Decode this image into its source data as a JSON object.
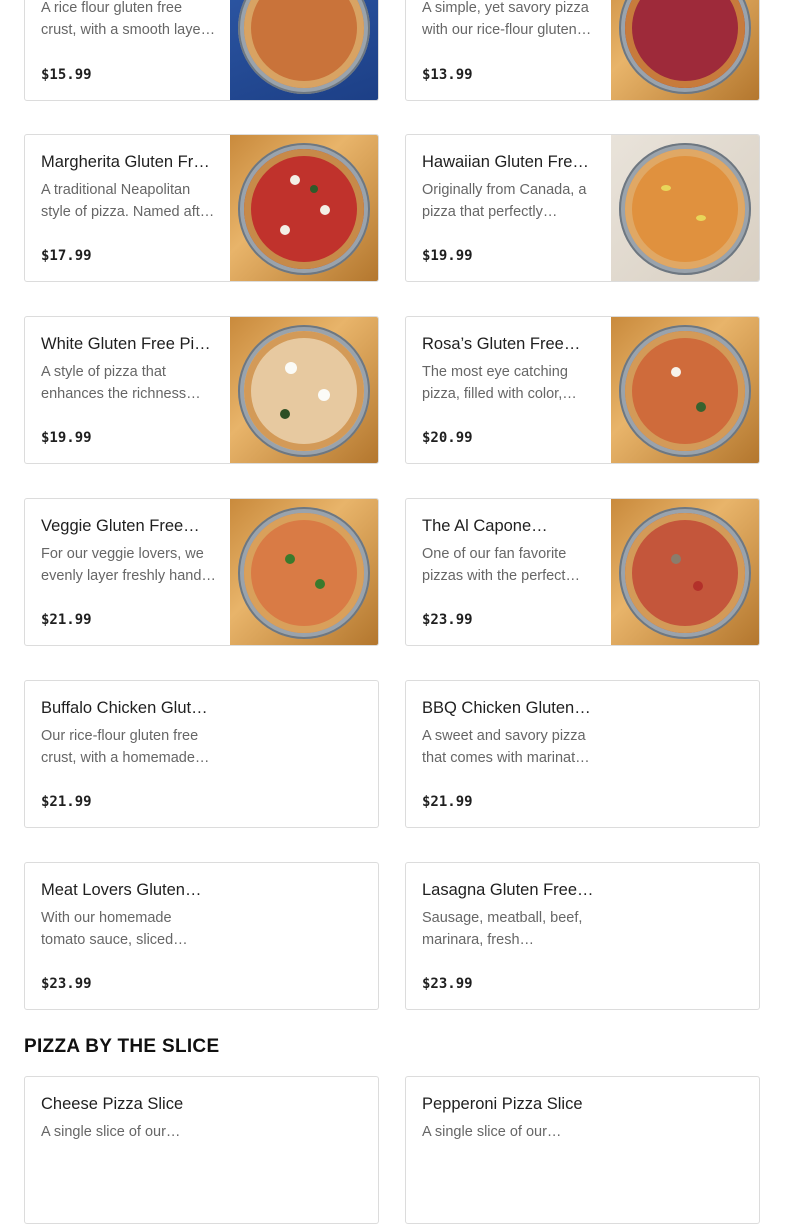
{
  "menu_items": [
    {
      "name": "",
      "description": "A rice flour gluten free crust, with a smooth laye…",
      "price": "$15.99"
    },
    {
      "name": "",
      "description": "A simple, yet savory pizza with our rice-flour gluten…",
      "price": "$13.99"
    },
    {
      "name": "Margherita Gluten Fr…",
      "description": "A traditional Neapolitan style of pizza. Named aft…",
      "price": "$17.99"
    },
    {
      "name": "Hawaiian Gluten Free…",
      "description": "Originally from Canada, a pizza that perfectly…",
      "price": "$19.99"
    },
    {
      "name": "White Gluten Free Pizza",
      "description": "A style of pizza that enhances the richness an…",
      "price": "$19.99"
    },
    {
      "name": "Rosa’s Gluten Free…",
      "description": "The most eye catching pizza, filled with color,…",
      "price": "$20.99"
    },
    {
      "name": "Veggie Gluten Free…",
      "description": "For our veggie lovers, we evenly layer freshly hand…",
      "price": "$21.99"
    },
    {
      "name": "The Al Capone…",
      "description": "One of our fan favorite pizzas with the perfect mi…",
      "price": "$23.99"
    },
    {
      "name": "Buffalo Chicken Glut…",
      "description": "Our rice-flour gluten free crust, with a homemade…",
      "price": "$21.99"
    },
    {
      "name": "BBQ Chicken Gluten…",
      "description": "A sweet and savory pizza that comes with marinat…",
      "price": "$21.99"
    },
    {
      "name": "Meat Lovers Gluten…",
      "description": "With our homemade tomato sauce, sliced…",
      "price": "$23.99"
    },
    {
      "name": "Lasagna Gluten Free…",
      "description": "Sausage, meatball, beef, marinara, fresh mozzarell…",
      "price": "$23.99"
    }
  ],
  "section": {
    "title": "PIZZA BY THE SLICE"
  },
  "slice_items": [
    {
      "name": "Cheese Pizza Slice",
      "description": "A single slice of our…"
    },
    {
      "name": "Pepperoni Pizza Slice",
      "description": "A single slice of our…"
    }
  ],
  "colors": {
    "text": "#1f1f1f",
    "muted": "#666666",
    "border": "#dcdcdc"
  }
}
